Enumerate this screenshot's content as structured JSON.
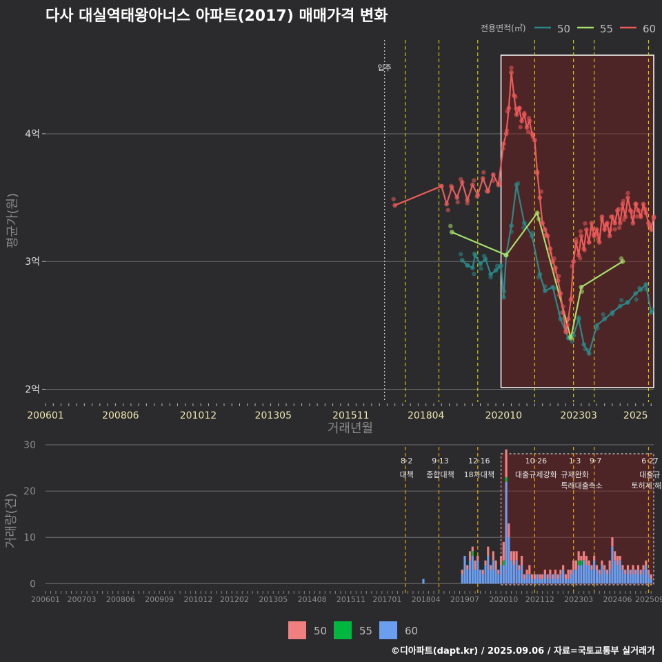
{
  "title": "다사 대실역태왕아너스 아파트(2017) 매매가격 변화",
  "credit": "©디아파트(dapt.kr) / 2025.09.06 / 자료=국토교통부 실거래가",
  "colors": {
    "s50": "#2a8a8a",
    "s55": "#a6e06a",
    "s60": "#ee5a5a",
    "bar50": "#f08080",
    "bar55": "#00b840",
    "bar60": "#6a9ff0",
    "vline": "#d4c800",
    "highlight": "#7a2020"
  },
  "chart_data": [
    {
      "type": "line",
      "title": "다사 대실역태왕아너스 아파트(2017) 매매가격 변화",
      "xlabel": "거래년월",
      "ylabel": "평균가(원)",
      "x_ticks": [
        "200601",
        "200806",
        "201012",
        "201305",
        "201511",
        "201804",
        "202010",
        "202303",
        "2025"
      ],
      "y_ticks": [
        "2억",
        "3억",
        "4억"
      ],
      "ylim": [
        1.9,
        4.75
      ],
      "legend_title": "전용면적(㎡)",
      "legend_position": "top-right",
      "annotation_movein": "입주",
      "series": [
        {
          "name": "50",
          "points": [
            [
              "2019-06",
              3.01
            ],
            [
              "2019-08",
              2.97
            ],
            [
              "2019-10",
              2.95
            ],
            [
              "2019-11",
              3.05
            ],
            [
              "2020-01",
              2.98
            ],
            [
              "2020-03",
              3.02
            ],
            [
              "2020-05",
              2.9
            ],
            [
              "2020-07",
              2.93
            ],
            [
              "2020-09",
              2.97
            ],
            [
              "2020-10",
              2.72
            ],
            [
              "2020-11",
              3.05
            ],
            [
              "2021-01",
              3.28
            ],
            [
              "2021-03",
              3.6
            ],
            [
              "2021-06",
              3.3
            ],
            [
              "2021-09",
              3.2
            ],
            [
              "2021-12",
              2.9
            ],
            [
              "2022-02",
              2.77
            ],
            [
              "2022-05",
              2.8
            ],
            [
              "2022-08",
              2.55
            ],
            [
              "2022-11",
              2.4
            ],
            [
              "2023-01",
              2.42
            ],
            [
              "2023-03",
              2.55
            ],
            [
              "2023-05",
              2.35
            ],
            [
              "2023-07",
              2.28
            ],
            [
              "2023-10",
              2.5
            ],
            [
              "2024-01",
              2.55
            ],
            [
              "2024-04",
              2.6
            ],
            [
              "2024-07",
              2.65
            ],
            [
              "2024-10",
              2.68
            ],
            [
              "2025-01",
              2.75
            ],
            [
              "2025-03",
              2.78
            ],
            [
              "2025-05",
              2.82
            ],
            [
              "2025-07",
              2.6
            ]
          ]
        },
        {
          "name": "55",
          "points": [
            [
              "2019-02",
              3.23
            ],
            [
              "2020-11",
              3.05
            ],
            [
              "2021-11",
              3.38
            ],
            [
              "2022-12",
              2.4
            ],
            [
              "2023-04",
              2.8
            ],
            [
              "2024-08",
              3.0
            ]
          ]
        },
        {
          "name": "60",
          "points": [
            [
              "2017-04",
              3.44
            ],
            [
              "2018-10",
              3.59
            ],
            [
              "2018-12",
              3.45
            ],
            [
              "2019-02",
              3.58
            ],
            [
              "2019-04",
              3.5
            ],
            [
              "2019-06",
              3.62
            ],
            [
              "2019-08",
              3.48
            ],
            [
              "2019-10",
              3.6
            ],
            [
              "2019-12",
              3.52
            ],
            [
              "2020-02",
              3.65
            ],
            [
              "2020-04",
              3.55
            ],
            [
              "2020-06",
              3.68
            ],
            [
              "2020-08",
              3.6
            ],
            [
              "2020-10",
              3.92
            ],
            [
              "2020-11",
              4.0
            ],
            [
              "2020-12",
              4.2
            ],
            [
              "2021-01",
              4.48
            ],
            [
              "2021-02",
              4.3
            ],
            [
              "2021-03",
              4.15
            ],
            [
              "2021-04",
              4.2
            ],
            [
              "2021-05",
              4.1
            ],
            [
              "2021-06",
              4.15
            ],
            [
              "2021-07",
              4.05
            ],
            [
              "2021-08",
              4.1
            ],
            [
              "2021-09",
              4.0
            ],
            [
              "2021-10",
              3.95
            ],
            [
              "2021-11",
              3.7
            ],
            [
              "2021-12",
              3.5
            ],
            [
              "2022-01",
              3.3
            ],
            [
              "2022-02",
              3.25
            ],
            [
              "2022-03",
              3.2
            ],
            [
              "2022-04",
              3.1
            ],
            [
              "2022-05",
              3.0
            ],
            [
              "2022-06",
              2.95
            ],
            [
              "2022-07",
              2.85
            ],
            [
              "2022-08",
              2.75
            ],
            [
              "2022-09",
              2.6
            ],
            [
              "2022-10",
              2.45
            ],
            [
              "2022-11",
              2.55
            ],
            [
              "2022-12",
              2.7
            ],
            [
              "2023-01",
              3.0
            ],
            [
              "2023-02",
              3.15
            ],
            [
              "2023-03",
              3.05
            ],
            [
              "2023-04",
              3.2
            ],
            [
              "2023-05",
              3.1
            ],
            [
              "2023-06",
              3.25
            ],
            [
              "2023-07",
              3.15
            ],
            [
              "2023-08",
              3.3
            ],
            [
              "2023-09",
              3.2
            ],
            [
              "2023-10",
              3.25
            ],
            [
              "2023-11",
              3.15
            ],
            [
              "2023-12",
              3.35
            ],
            [
              "2024-01",
              3.25
            ],
            [
              "2024-02",
              3.3
            ],
            [
              "2024-03",
              3.2
            ],
            [
              "2024-04",
              3.35
            ],
            [
              "2024-05",
              3.3
            ],
            [
              "2024-06",
              3.4
            ],
            [
              "2024-07",
              3.3
            ],
            [
              "2024-08",
              3.45
            ],
            [
              "2024-09",
              3.35
            ],
            [
              "2024-10",
              3.5
            ],
            [
              "2024-11",
              3.4
            ],
            [
              "2024-12",
              3.3
            ],
            [
              "2025-01",
              3.45
            ],
            [
              "2025-02",
              3.4
            ],
            [
              "2025-03",
              3.35
            ],
            [
              "2025-04",
              3.45
            ],
            [
              "2025-05",
              3.38
            ],
            [
              "2025-06",
              3.3
            ],
            [
              "2025-07",
              3.25
            ],
            [
              "2025-08",
              3.35
            ]
          ]
        }
      ]
    },
    {
      "type": "bar",
      "ylabel": "거래량(건)",
      "x_ticks": [
        "200601",
        "200703",
        "200806",
        "200909",
        "201012",
        "201202",
        "201305",
        "201408",
        "201511",
        "201701",
        "201804",
        "201907",
        "202010",
        "202112",
        "202303",
        "202406",
        "202509"
      ],
      "y_ticks": [
        "0",
        "10",
        "20",
        "30"
      ],
      "ylim": [
        -1,
        30
      ],
      "legend": [
        "50",
        "55",
        "60"
      ],
      "legend_position": "bottom",
      "policies": [
        {
          "date": "2017-08",
          "date_label": "8·2",
          "label": "대책",
          "label2": ""
        },
        {
          "date": "2018-09",
          "date_label": "9·13",
          "label": "종합대책",
          "label2": ""
        },
        {
          "date": "2019-12",
          "date_label": "12·16",
          "label": "18차대책",
          "label2": ""
        },
        {
          "date": "2021-10",
          "date_label": "10·26",
          "label": "대출규제강화",
          "label2": ""
        },
        {
          "date": "2023-01",
          "date_label": "1·3",
          "label": "규제완화",
          "label2": "특례대출"
        },
        {
          "date": "2023-09",
          "date_label": "9·7",
          "label": "",
          "label2": "축소"
        },
        {
          "date": "2025-06",
          "date_label": "6·27",
          "label": "대출규",
          "label2": "토허제 해제"
        }
      ],
      "bars": [
        [
          "2018-03",
          0,
          0,
          1
        ],
        [
          "2019-06",
          1,
          0,
          2
        ],
        [
          "2019-07",
          0,
          0,
          6
        ],
        [
          "2019-08",
          1,
          0,
          3
        ],
        [
          "2019-09",
          2,
          0,
          5
        ],
        [
          "2019-10",
          1,
          1,
          6
        ],
        [
          "2019-11",
          2,
          0,
          3
        ],
        [
          "2019-12",
          1,
          0,
          5
        ],
        [
          "2020-01",
          0,
          0,
          3
        ],
        [
          "2020-02",
          1,
          0,
          2
        ],
        [
          "2020-03",
          1,
          0,
          4
        ],
        [
          "2020-04",
          2,
          0,
          6
        ],
        [
          "2020-05",
          1,
          0,
          3
        ],
        [
          "2020-06",
          2,
          0,
          5
        ],
        [
          "2020-07",
          2,
          0,
          3
        ],
        [
          "2020-08",
          1,
          0,
          2
        ],
        [
          "2020-09",
          2,
          0,
          4
        ],
        [
          "2020-10",
          4,
          1,
          4
        ],
        [
          "2020-11",
          6,
          1,
          22
        ],
        [
          "2020-12",
          3,
          0,
          10
        ],
        [
          "2021-01",
          2,
          0,
          5
        ],
        [
          "2021-02",
          3,
          0,
          4
        ],
        [
          "2021-03",
          2,
          0,
          5
        ],
        [
          "2021-04",
          1,
          0,
          3
        ],
        [
          "2021-05",
          2,
          0,
          4
        ],
        [
          "2021-06",
          1,
          0,
          1
        ],
        [
          "2021-07",
          1,
          0,
          2
        ],
        [
          "2021-08",
          2,
          0,
          2
        ],
        [
          "2021-09",
          1,
          0,
          1
        ],
        [
          "2021-10",
          1,
          0,
          1
        ],
        [
          "2021-11",
          0,
          0,
          2
        ],
        [
          "2021-12",
          1,
          0,
          1
        ],
        [
          "2022-01",
          1,
          0,
          1
        ],
        [
          "2022-02",
          1,
          0,
          2
        ],
        [
          "2022-03",
          1,
          0,
          1
        ],
        [
          "2022-04",
          1,
          0,
          2
        ],
        [
          "2022-05",
          1,
          0,
          1
        ],
        [
          "2022-06",
          1,
          0,
          2
        ],
        [
          "2022-07",
          1,
          0,
          1
        ],
        [
          "2022-08",
          1,
          0,
          2
        ],
        [
          "2022-09",
          1,
          0,
          3
        ],
        [
          "2022-10",
          1,
          0,
          1
        ],
        [
          "2022-11",
          2,
          0,
          1
        ],
        [
          "2022-12",
          1,
          0,
          2
        ],
        [
          "2023-01",
          2,
          0,
          3
        ],
        [
          "2023-02",
          2,
          0,
          3
        ],
        [
          "2023-03",
          2,
          1,
          4
        ],
        [
          "2023-04",
          1,
          1,
          4
        ],
        [
          "2023-05",
          2,
          0,
          5
        ],
        [
          "2023-06",
          2,
          0,
          4
        ],
        [
          "2023-07",
          1,
          0,
          4
        ],
        [
          "2023-08",
          1,
          0,
          3
        ],
        [
          "2023-09",
          1,
          0,
          5
        ],
        [
          "2023-10",
          1,
          0,
          3
        ],
        [
          "2023-11",
          1,
          0,
          2
        ],
        [
          "2023-12",
          1,
          0,
          4
        ],
        [
          "2024-01",
          1,
          0,
          3
        ],
        [
          "2024-02",
          1,
          0,
          2
        ],
        [
          "2024-03",
          2,
          0,
          3
        ],
        [
          "2024-04",
          2,
          0,
          8
        ],
        [
          "2024-05",
          2,
          0,
          5
        ],
        [
          "2024-06",
          2,
          0,
          4
        ],
        [
          "2024-07",
          1,
          0,
          5
        ],
        [
          "2024-08",
          1,
          0,
          3
        ],
        [
          "2024-09",
          1,
          0,
          2
        ],
        [
          "2024-10",
          1,
          0,
          3
        ],
        [
          "2024-11",
          1,
          0,
          2
        ],
        [
          "2024-12",
          1,
          0,
          3
        ],
        [
          "2025-01",
          1,
          0,
          2
        ],
        [
          "2025-02",
          1,
          0,
          3
        ],
        [
          "2025-03",
          1,
          0,
          2
        ],
        [
          "2025-04",
          1,
          0,
          3
        ],
        [
          "2025-05",
          1,
          0,
          4
        ],
        [
          "2025-06",
          1,
          0,
          2
        ],
        [
          "2025-07",
          1,
          0,
          1
        ]
      ]
    }
  ]
}
